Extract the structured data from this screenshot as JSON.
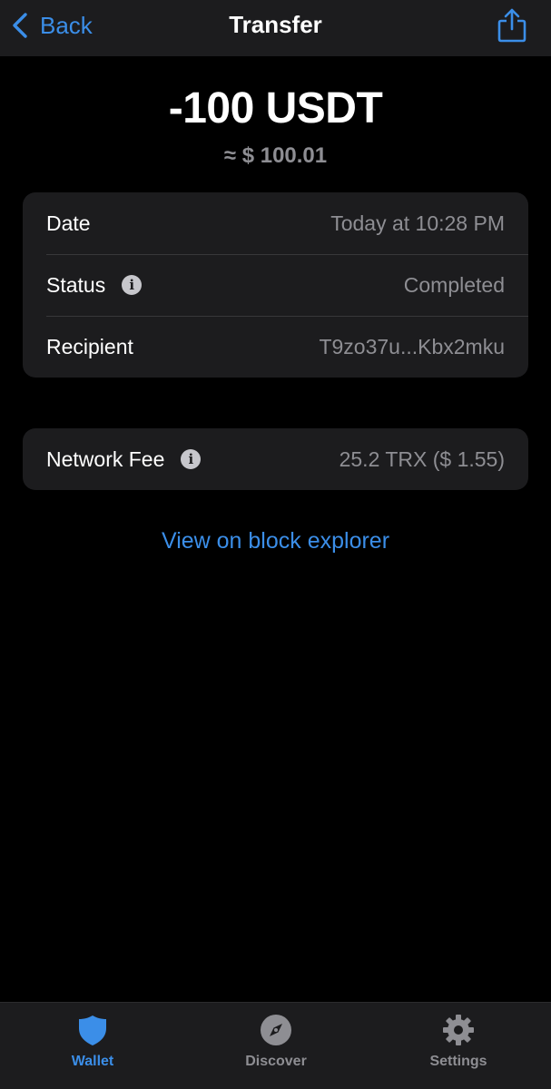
{
  "header": {
    "back_label": "Back",
    "title": "Transfer",
    "accent_color": "#3b8ee8"
  },
  "amount": {
    "value": "-100 USDT",
    "fiat": "≈ $ 100.01"
  },
  "details": [
    {
      "label": "Date",
      "value": "Today at 10:28 PM",
      "info": false
    },
    {
      "label": "Status",
      "value": "Completed",
      "info": true
    },
    {
      "label": "Recipient",
      "value": "T9zo37u...Kbx2mku",
      "info": false
    }
  ],
  "fee": {
    "label": "Network Fee",
    "value": "25.2 TRX ($ 1.55)",
    "info": true
  },
  "explorer_link": "View on block explorer",
  "tabs": [
    {
      "label": "Wallet",
      "icon": "shield-icon",
      "active": true
    },
    {
      "label": "Discover",
      "icon": "compass-icon",
      "active": false
    },
    {
      "label": "Settings",
      "icon": "gear-icon",
      "active": false
    }
  ]
}
